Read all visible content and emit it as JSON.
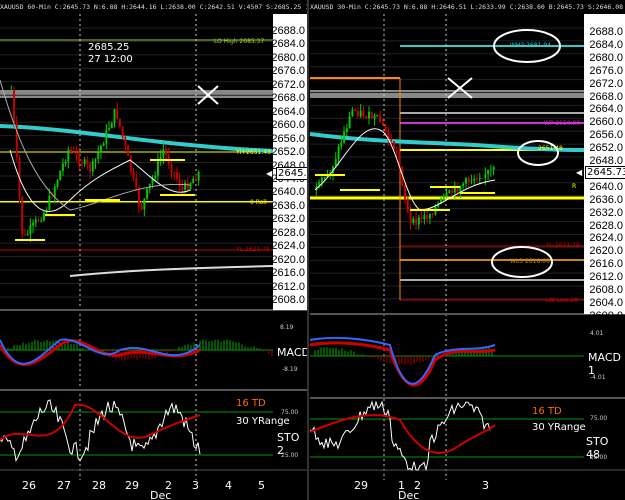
{
  "left": {
    "header": "XAUUSD 60-Min C:2645.73 N:6.88 H:2644.16 L:2638.00 C:2642.51 V:4507 S:2685.25 11-27-24 5:48",
    "y_ticks": [
      "2688.0",
      "2684.0",
      "2680.0",
      "2676.0",
      "2672.0",
      "2668.0",
      "2664.0",
      "2660.0",
      "2656.0",
      "2652.0",
      "2648.0",
      "2644.0",
      "2640.0",
      "2636.0",
      "2632.0",
      "2628.0",
      "2624.0",
      "2620.0",
      "2616.0",
      "2612.0",
      "2608.0"
    ],
    "crosshair_price": "2685.25",
    "crosshair_time": "27 12:00",
    "price_box": "2645.7",
    "level_labels": {
      "lo_high": "LO High 2685.37",
      "yh": "YH 2651.48",
      "roll": "0 Roll",
      "yl": "YL 2621.79"
    },
    "macd_label": "MACD",
    "macd_ticks": [
      "8.19",
      "-8.19"
    ],
    "td_label": "16 TD",
    "yrange_label": "30 YRange",
    "sto_label": "STO 2",
    "sto_ticks": [
      "75.00",
      "25.00"
    ],
    "x_labels": [
      "26",
      "27",
      "28",
      "29",
      "2",
      "3",
      "4",
      "5"
    ],
    "x_month": "Dec"
  },
  "right": {
    "header": "XAUUSD 30-Min C:2645.73 N:6.88 H:2646.51 L:2633.99 C:2638.60 B:2645.73 S:2646.08 V:28.6K 12-03-24 5:48",
    "y_ticks": [
      "2688.0",
      "2684.0",
      "2680.0",
      "2676.0",
      "2672.0",
      "2668.0",
      "2664.0",
      "2660.0",
      "2656.0",
      "2652.0",
      "2648.0",
      "2644.0",
      "2640.0",
      "2636.0",
      "2632.0",
      "2628.0",
      "2624.0",
      "2620.0",
      "2616.0",
      "2612.0",
      "2608.0",
      "2604.0",
      "2600.0"
    ],
    "price_box": "2645.73",
    "level_labels": {
      "wh3": "WH3 2681.94",
      "wp": "WP 2650.00",
      "yh": "2651.48",
      "r": "R",
      "yl": "YL 2621.79",
      "wl3": "WL3 2618.06",
      "lw_low": "LW Low 28"
    },
    "macd_label": "MACD 1",
    "macd_ticks": [
      "4.01",
      "-4.01"
    ],
    "td_label": "16 TD",
    "yrange_label": "30 YRange",
    "sto_label": "STO 48",
    "sto_ticks": [
      "75.00",
      "25.00"
    ],
    "x_labels": [
      "29",
      "1",
      "2",
      "3"
    ],
    "x_month": "Dec"
  },
  "colors": {
    "bull": "#00cc00",
    "bear": "#cc0000",
    "cyan_ma": "#33cccc",
    "yellow_level": "#ffff00",
    "red_level": "#cc0000",
    "grey_band": "#777777"
  }
}
